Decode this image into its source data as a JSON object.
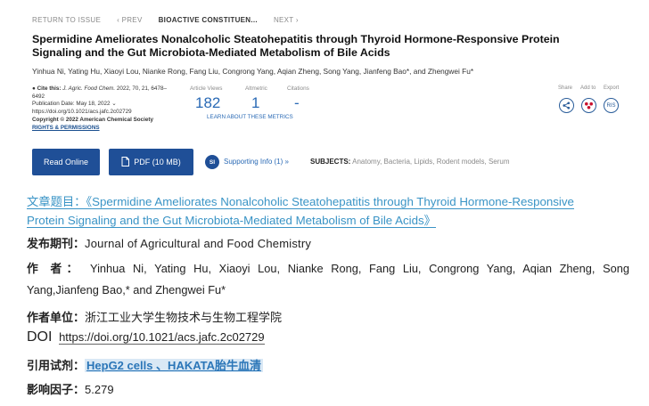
{
  "nav": {
    "return": "RETURN TO ISSUE",
    "prev": "‹ PREV",
    "current": "BIOACTIVE CONSTITUEN...",
    "next": "NEXT ›"
  },
  "article": {
    "title_line1": "Spermidine Ameliorates Nonalcoholic Steatohepatitis through Thyroid Hormone-Responsive Protein",
    "title_line2": "Signaling and the Gut Microbiota-Mediated Metabolism of Bile Acids",
    "authors": "Yinhua Ni, Yating Hu, Xiaoyi Lou, Nianke Rong, Fang Liu, Congrong Yang, Aqian Zheng, Song Yang, Jianfeng Bao*, and Zhengwei Fu*"
  },
  "cite": {
    "label": "Cite this:",
    "journal": "J. Agric. Food Chem.",
    "detail_1": "2022, 70, 21, 6478–",
    "detail_2": "6492",
    "pub_date": "Publication Date: May 18, 2022",
    "doi_url": "https://doi.org/10.1021/acs.jafc.2c02729",
    "copyright": "Copyright © 2022 American Chemical Society",
    "rights": "RIGHTS & PERMISSIONS"
  },
  "metrics": {
    "views_label": "Article Views",
    "views_value": "182",
    "altmetric_label": "Altmetric",
    "altmetric_value": "1",
    "citations_label": "Citations",
    "citations_value": "-",
    "learn_more": "LEARN ABOUT THESE METRICS"
  },
  "share": {
    "share_label": "Share",
    "add_label": "Add to",
    "export_label": "Export",
    "ris": "RIS"
  },
  "actions": {
    "read_online": "Read Online",
    "pdf": "PDF (10 MB)",
    "si_badge": "SI",
    "supporting_info": "Supporting Info (1) »",
    "subjects_label": "SUBJECTS:",
    "subjects": "Anatomy, Bacteria, Lipids, Rodent models, Serum"
  },
  "info": {
    "title_label": "文章题目：",
    "title_line1": "《Spermidine Ameliorates Nonalcoholic Steatohepatitis through Thyroid Hormone-Responsive",
    "title_line2": "Protein Signaling and the Gut Microbiota-Mediated Metabolism of Bile Acids》",
    "journal_label": "发布期刊：",
    "journal_value": "Journal of Agricultural and Food Chemistry",
    "author_label": "作 者：",
    "author_line1": "Yinhua Ni, Yating Hu, Xiaoyi Lou, Nianke Rong, Fang Liu, Congrong Yang, Aqian Zheng, Song",
    "author_line2": "Yang,Jianfeng Bao,* and Zhengwei Fu*",
    "unit_label": "作者单位：",
    "unit_value": "浙江工业大学生物技术与生物工程学院",
    "doi_label": "DOI",
    "doi_value": "https://doi.org/10.1021/acs.jafc.2c02729",
    "reagent_label": "引用试剂：",
    "reagent_value": "HepG2 cells 、HAKATA胎牛血清",
    "impact_label": "影响因子：",
    "impact_value": "5.279"
  },
  "colors": {
    "acs_blue": "#1f4f97",
    "link_blue": "#2a6ab5",
    "title_blue": "#3a94c6",
    "altmetric_red": "#c8102e"
  }
}
